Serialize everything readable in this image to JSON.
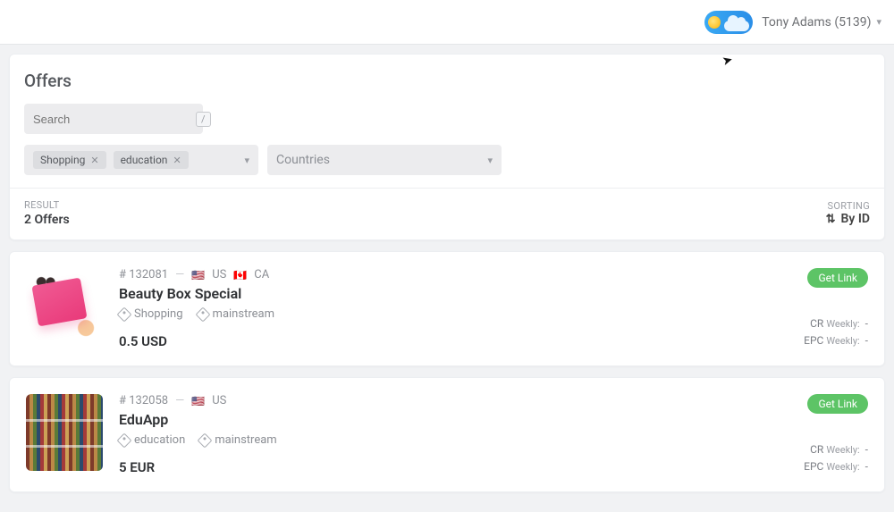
{
  "header": {
    "user_label": "Tony Adams (5139)"
  },
  "page": {
    "title": "Offers"
  },
  "search": {
    "placeholder": "Search",
    "shortcut": "/"
  },
  "filters": {
    "tags": {
      "chips": [
        "Shopping",
        "education"
      ]
    },
    "countries": {
      "placeholder": "Countries"
    }
  },
  "summary": {
    "result_label": "RESULT",
    "result_value": "2 Offers",
    "sorting_label": "SORTING",
    "sorting_value": "By ID"
  },
  "offers": [
    {
      "id": "132081",
      "id_display": "# 132081",
      "countries": [
        {
          "code": "US",
          "flag": "🇺🇸"
        },
        {
          "code": "CA",
          "flag": "🇨🇦"
        }
      ],
      "title": "Beauty Box Special",
      "tags": [
        "Shopping",
        "mainstream"
      ],
      "payout": "0.5 USD",
      "cr_label": "CR",
      "cr_period": "Weekly:",
      "cr_value": "-",
      "epc_label": "EPC",
      "epc_period": "Weekly:",
      "epc_value": "-",
      "button": "Get Link"
    },
    {
      "id": "132058",
      "id_display": "# 132058",
      "countries": [
        {
          "code": "US",
          "flag": "🇺🇸"
        }
      ],
      "title": "EduApp",
      "tags": [
        "education",
        "mainstream"
      ],
      "payout": "5 EUR",
      "cr_label": "CR",
      "cr_period": "Weekly:",
      "cr_value": "-",
      "epc_label": "EPC",
      "epc_period": "Weekly:",
      "epc_value": "-",
      "button": "Get Link"
    }
  ]
}
